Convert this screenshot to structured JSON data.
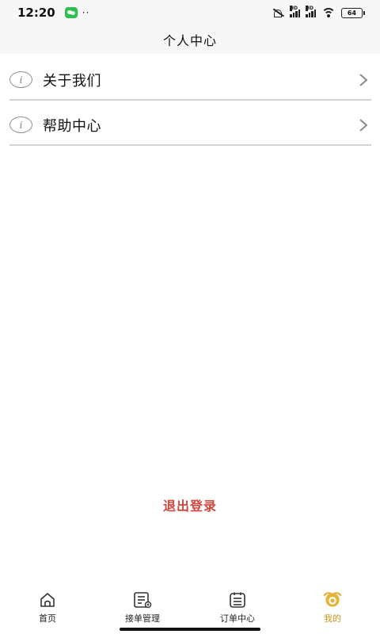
{
  "status_bar": {
    "time": "12:20",
    "dots": "··",
    "signal_badge_1": "HD",
    "signal_badge_2": "HD",
    "battery": "64"
  },
  "header": {
    "title": "个人中心"
  },
  "menu": {
    "items": [
      {
        "label": "关于我们",
        "icon": "info-icon",
        "info_glyph": "i"
      },
      {
        "label": "帮助中心",
        "icon": "info-icon",
        "info_glyph": "i"
      }
    ]
  },
  "logout": {
    "label": "退出登录"
  },
  "tabs": {
    "items": [
      {
        "label": "首页",
        "icon": "home-icon",
        "active": false
      },
      {
        "label": "接单管理",
        "icon": "order-manage-icon",
        "active": false
      },
      {
        "label": "订单中心",
        "icon": "order-list-icon",
        "active": false
      },
      {
        "label": "我的",
        "icon": "profile-icon",
        "active": true
      }
    ]
  },
  "colors": {
    "accent": "#c8951c",
    "logout": "#d0473c",
    "divider": "#d2d2d2",
    "header_bg": "#f7f7f7"
  }
}
